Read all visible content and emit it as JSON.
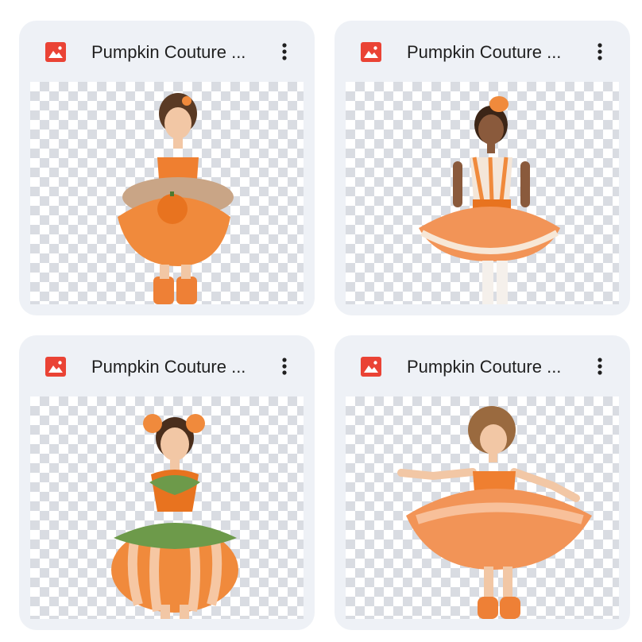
{
  "files": [
    {
      "title": "Pumpkin Couture ...",
      "icon": "image-file-icon"
    },
    {
      "title": "Pumpkin Couture ...",
      "icon": "image-file-icon"
    },
    {
      "title": "Pumpkin Couture ...",
      "icon": "image-file-icon"
    },
    {
      "title": "Pumpkin Couture ...",
      "icon": "image-file-icon"
    }
  ],
  "colors": {
    "card_background": "#eef1f6",
    "image_icon_red": "#ea4335",
    "title_text": "#1f1f1f",
    "checker": "#d9dce2",
    "costume_orange": "#f08a3c"
  }
}
